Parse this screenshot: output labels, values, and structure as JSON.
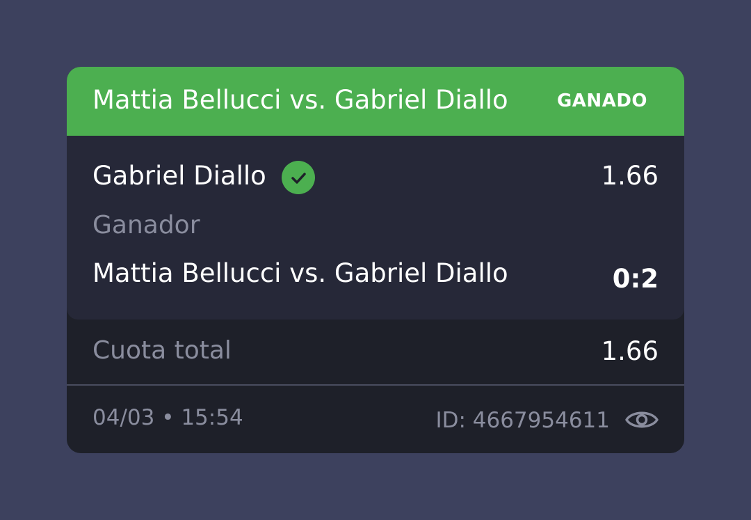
{
  "bet": {
    "header": {
      "title": "Mattia Bellucci vs. Gabriel Diallo",
      "status": "GANADO",
      "color": "#4caf50"
    },
    "selection": {
      "pick": "Gabriel Diallo",
      "pick_icon": "check-circle-icon",
      "odds": "1.66",
      "market": "Ganador",
      "event": "Mattia Bellucci vs. Gabriel Diallo",
      "score": "0:2"
    },
    "total": {
      "label": "Cuota total",
      "value": "1.66"
    },
    "footer": {
      "datetime": "04/03 • 15:54",
      "id_label": "ID:  4667954611",
      "view_icon": "eye-icon"
    }
  }
}
